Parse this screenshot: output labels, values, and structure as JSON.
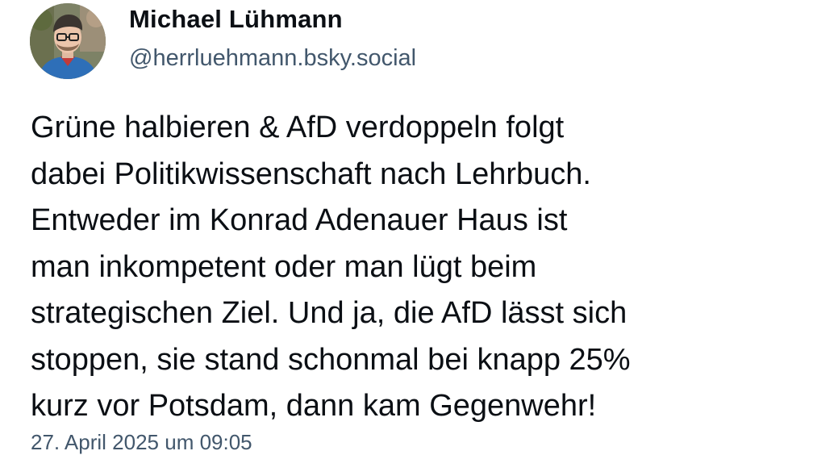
{
  "author": {
    "display_name": "Michael Lühmann",
    "handle": "@herrluehmann.bsky.social",
    "avatar_icon": "profile-photo"
  },
  "post": {
    "lines": [
      "Grüne halbieren & AfD verdoppeln folgt",
      "dabei Politikwissenschaft nach Lehrbuch.",
      "Entweder im Konrad Adenauer Haus ist",
      "man inkompetent oder man lügt beim",
      "strategischen Ziel. Und ja, die AfD lässt sich",
      "stoppen, sie stand schonmal bei knapp 25%",
      "kurz vor Potsdam, dann kam Gegenwehr!"
    ],
    "timestamp": "27. April 2025 um 09:05"
  },
  "colors": {
    "text_primary": "#0b0f14",
    "text_secondary": "#42576c",
    "background": "#ffffff"
  }
}
